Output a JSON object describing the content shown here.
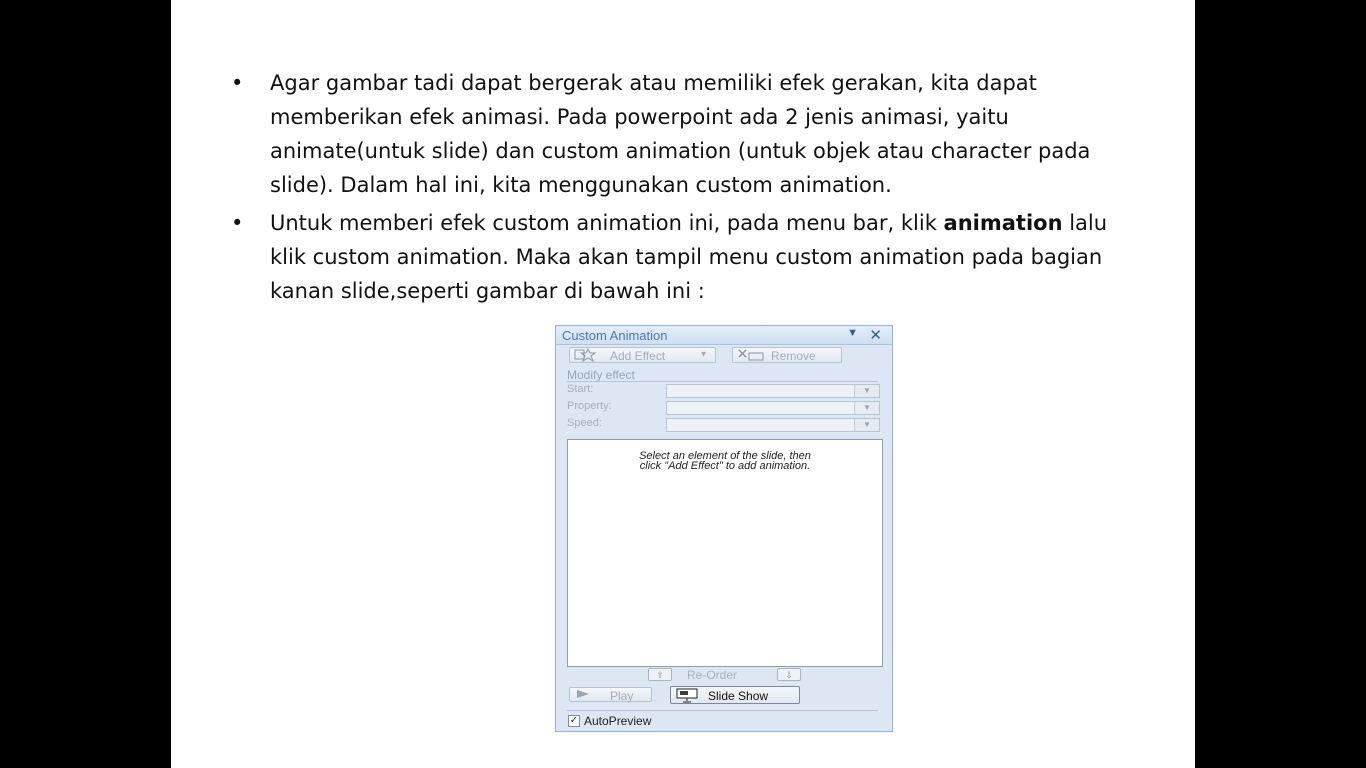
{
  "slide": {
    "bullets": [
      {
        "marker": "•",
        "text": "Agar gambar tadi dapat bergerak atau memiliki efek gerakan, kita dapat memberikan efek animasi. Pada powerpoint ada 2 jenis animasi, yaitu animate(untuk slide) dan custom animation (untuk objek atau character pada slide). Dalam hal ini, kita menggunakan custom animation."
      },
      {
        "marker": "•",
        "text_before": "Untuk memberi efek custom animation ini, pada menu bar, klik ",
        "bold": "animation",
        "text_after": " lalu klik custom animation. Maka akan tampil menu custom animation pada bagian kanan slide,seperti gambar di bawah ini :"
      }
    ]
  },
  "pane": {
    "title": "Custom Animation",
    "menu_icon": "▼",
    "close_icon": "✕",
    "add_effect": {
      "icon": "add-effect-star-icon",
      "label": "Add Effect",
      "dropdown": "▾"
    },
    "remove": {
      "icon": "remove-effect-icon",
      "label": "Remove"
    },
    "modify_effect_label": "Modify effect",
    "fields": [
      {
        "label": "Start:",
        "value": ""
      },
      {
        "label": "Property:",
        "value": ""
      },
      {
        "label": "Speed:",
        "value": ""
      }
    ],
    "list_hint_line1": "Select an element of the slide, then",
    "list_hint_line2": "click \"Add Effect\" to add animation.",
    "reorder": {
      "label": "Re-Order",
      "up_icon": "⇧",
      "down_icon": "⇩"
    },
    "play": {
      "icon": "play-icon",
      "label": "Play"
    },
    "slide_show": {
      "icon": "slide-show-icon",
      "label": "Slide Show"
    },
    "autopreview": {
      "label": "AutoPreview",
      "checked": true,
      "check_mark": "✓"
    }
  }
}
